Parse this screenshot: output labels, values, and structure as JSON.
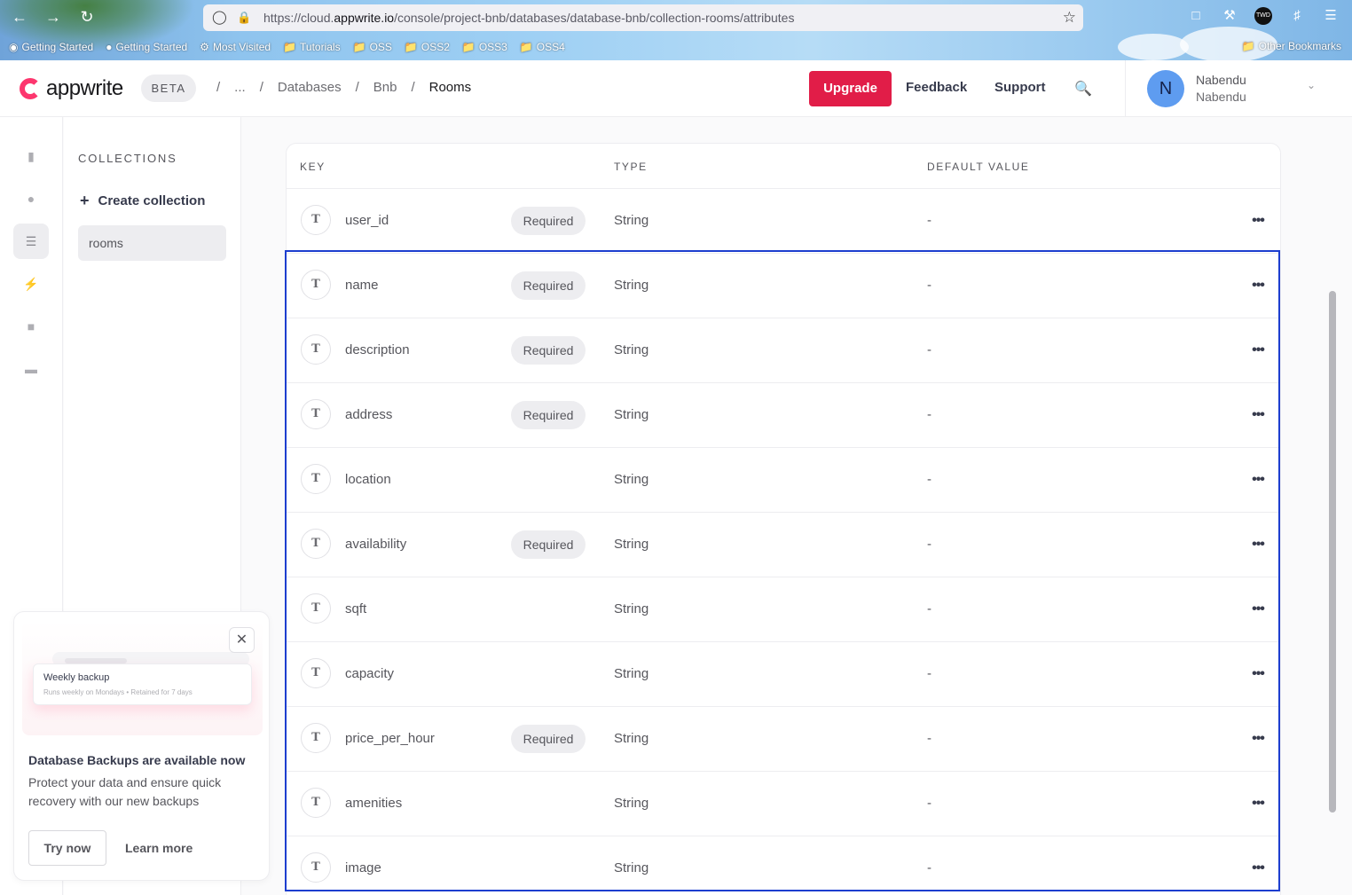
{
  "browser": {
    "url_prefix": "https://cloud.",
    "url_domain": "appwrite.io",
    "url_path": "/console/project-bnb/databases/database-bnb/collection-rooms/attributes",
    "bookmarks": [
      "Getting Started",
      "Getting Started",
      "Most Visited",
      "Tutorials",
      "OSS",
      "OSS2",
      "OSS3",
      "OSS4"
    ],
    "other_bookmarks": "Other Bookmarks",
    "profile_badge": "TWD"
  },
  "header": {
    "logo": "appwrite",
    "beta": "BETA",
    "breadcrumbs": [
      "...",
      "Databases",
      "Bnb",
      "Rooms"
    ],
    "upgrade": "Upgrade",
    "feedback": "Feedback",
    "support": "Support",
    "user": {
      "initial": "N",
      "name": "Nabendu",
      "email": "Nabendu"
    }
  },
  "sidebar": {
    "collections_title": "COLLECTIONS",
    "create_collection": "Create collection",
    "collections": [
      "rooms"
    ]
  },
  "table": {
    "headers": {
      "key": "KEY",
      "type": "TYPE",
      "default": "DEFAULT VALUE"
    },
    "type_icon": "T",
    "required_label": "Required",
    "rows": [
      {
        "key": "user_id",
        "required": true,
        "type": "String",
        "default": "-"
      },
      {
        "key": "name",
        "required": true,
        "type": "String",
        "default": "-"
      },
      {
        "key": "description",
        "required": true,
        "type": "String",
        "default": "-"
      },
      {
        "key": "address",
        "required": true,
        "type": "String",
        "default": "-"
      },
      {
        "key": "location",
        "required": false,
        "type": "String",
        "default": "-"
      },
      {
        "key": "availability",
        "required": true,
        "type": "String",
        "default": "-"
      },
      {
        "key": "sqft",
        "required": false,
        "type": "String",
        "default": "-"
      },
      {
        "key": "capacity",
        "required": false,
        "type": "String",
        "default": "-"
      },
      {
        "key": "price_per_hour",
        "required": true,
        "type": "String",
        "default": "-"
      },
      {
        "key": "amenities",
        "required": false,
        "type": "String",
        "default": "-"
      },
      {
        "key": "image",
        "required": false,
        "type": "String",
        "default": "-"
      }
    ]
  },
  "promo": {
    "card_title": "Weekly backup",
    "card_sub": "Runs weekly on Mondays • Retained for 7 days",
    "title": "Database Backups are available now",
    "description": "Protect your data and ensure quick recovery with our new backups",
    "try_now": "Try now",
    "learn_more": "Learn more"
  },
  "colors": {
    "accent": "#e11d48",
    "brand": "#fd366e",
    "selection": "#1d3ecf"
  }
}
